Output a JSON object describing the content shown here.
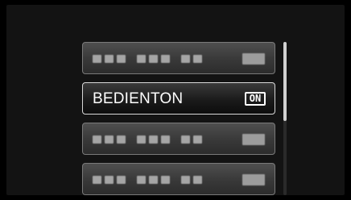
{
  "menu": {
    "items": [
      {
        "name": "menu-item-1",
        "label": "",
        "status": "",
        "blurred": true
      },
      {
        "name": "menu-item-bedienton",
        "label": "BEDIENTON",
        "status": "ON",
        "blurred": false,
        "selected": true
      },
      {
        "name": "menu-item-3",
        "label": "",
        "status": "",
        "blurred": true
      },
      {
        "name": "menu-item-4",
        "label": "",
        "status": "",
        "blurred": true
      }
    ]
  },
  "scrollbar": {
    "position_fraction": 0.3
  },
  "colors": {
    "background": "#000000",
    "panel": "#131313",
    "selected_border": "#d8d8d8",
    "item_border": "#7a7a7a",
    "text": "#ffffff"
  }
}
